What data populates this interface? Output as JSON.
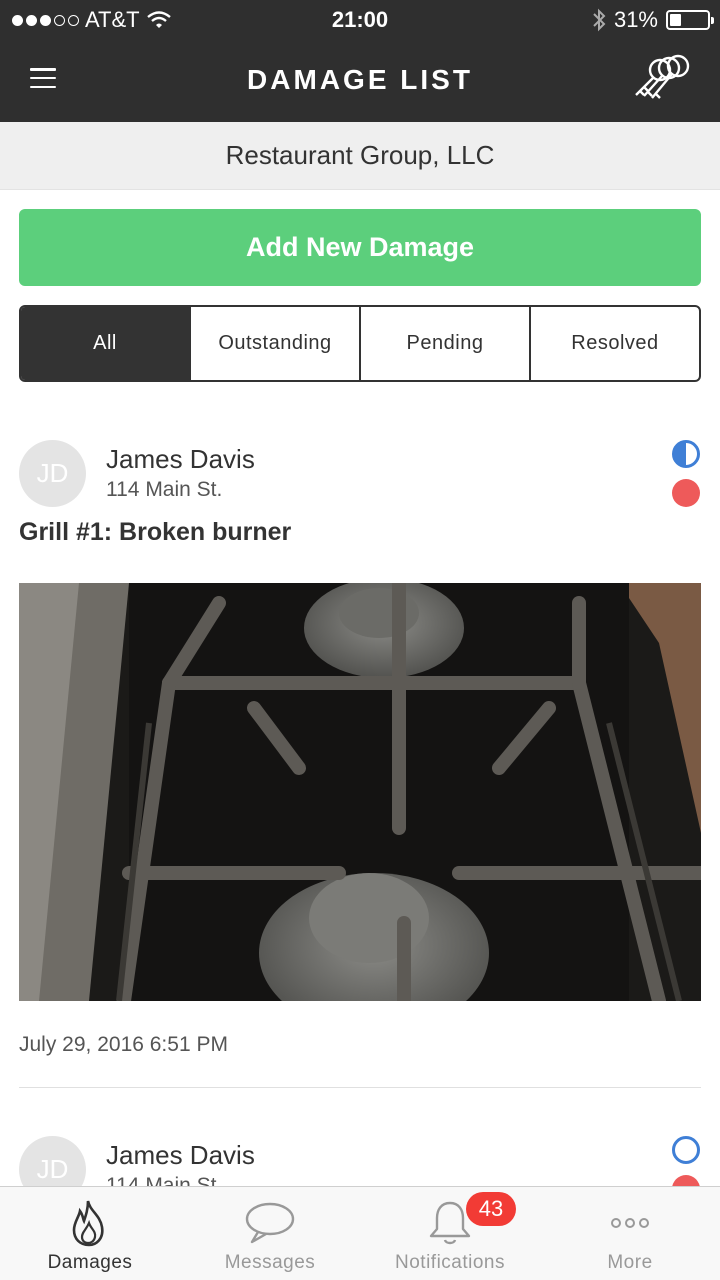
{
  "status_bar": {
    "carrier": "AT&T",
    "signal_bars_filled": 3,
    "signal_bars_total": 5,
    "time": "21:00",
    "battery_percent_label": "31%",
    "battery_level": 0.31
  },
  "nav": {
    "brand": "DAMAGE LIST",
    "menu_icon": "hamburger-icon",
    "account_icon": "keys-icon"
  },
  "company": {
    "name": "Restaurant Group, LLC"
  },
  "add_button": {
    "label": "Add New Damage",
    "color": "#5ccf7c"
  },
  "filters": {
    "tabs": [
      "All",
      "Outstanding",
      "Pending",
      "Resolved"
    ],
    "active": "All"
  },
  "damages": [
    {
      "initials": "JD",
      "author": "James Davis",
      "address": "114 Main St.",
      "title": "Grill #1: Broken burner",
      "date": "July 29, 2016  6:51 PM",
      "status_icons": [
        "half-filled-circle-icon",
        "red-dot-icon"
      ],
      "photo": "stove-burner-photo"
    },
    {
      "initials": "JD",
      "author": "James Davis",
      "address": "114 Main St.",
      "status_icons": [
        "empty-circle-icon",
        "red-dot-icon"
      ]
    }
  ],
  "tabbar": {
    "items": [
      {
        "label": "Damages",
        "icon": "flame-icon",
        "active": true
      },
      {
        "label": "Messages",
        "icon": "chat-bubble-icon",
        "active": false
      },
      {
        "label": "Notifications",
        "icon": "bell-icon",
        "active": false,
        "badge": "43"
      },
      {
        "label": "More",
        "icon": "more-dots-icon",
        "active": false
      }
    ]
  },
  "colors": {
    "header_bg": "#2f2f2f",
    "accent_blue": "#3f7fd6",
    "alert_red": "#ee5a5a",
    "badge_red": "#f23b35"
  }
}
